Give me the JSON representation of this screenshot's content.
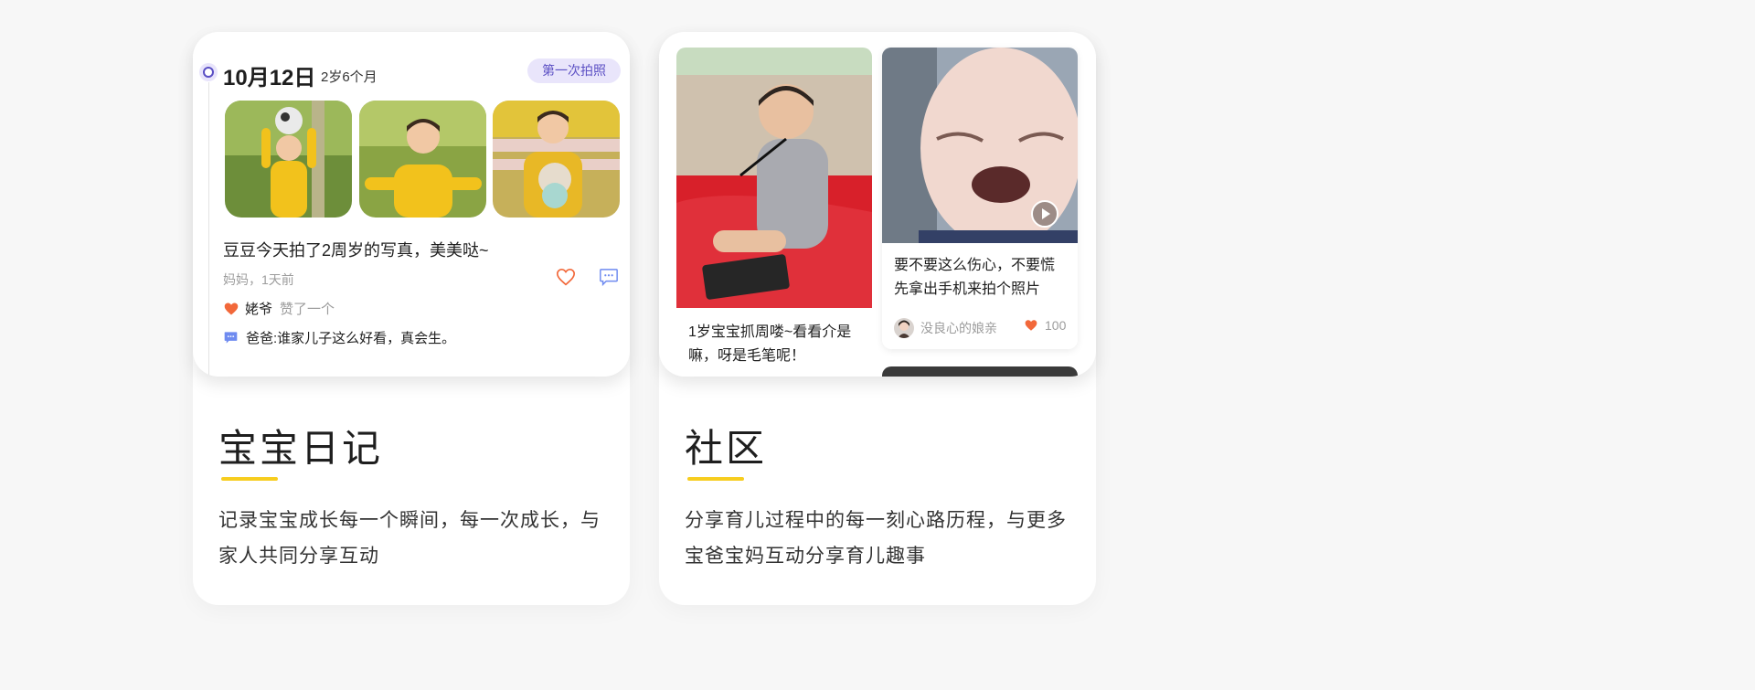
{
  "diary_card": {
    "preview": {
      "date": "10月12日",
      "age": "2岁6个月",
      "badge": "第一次拍照",
      "post_text": "豆豆今天拍了2周岁的写真，美美哒~",
      "meta": "妈妈，1天前",
      "liker": "姥爷",
      "liked_label": "赞了一个",
      "comment": "爸爸:谁家儿子这么好看，真会生。"
    },
    "title": "宝宝日记",
    "description": "记录宝宝成长每一个瞬间，每一次成长，与家人共同分享互动"
  },
  "community_card": {
    "posts": [
      {
        "caption": "1岁宝宝抓周喽~看看介是嘛，呀是毛笔呢！"
      },
      {
        "caption": "要不要这么伤心，不要慌先拿出手机来拍个照片",
        "author": "没良心的娘亲",
        "likes": "100"
      }
    ],
    "title": "社区",
    "description": "分享育儿过程中的每一刻心路历程，与更多宝爸宝妈互动分享育儿趣事"
  },
  "colors": {
    "accent_yellow": "#f7cd1e",
    "heart_orange": "#f2683a",
    "badge_purple": "#5c50c4",
    "comment_blue": "#6f8bf0"
  },
  "icons": [
    "timeline-dot-icon",
    "heart-icon",
    "comment-icon",
    "play-icon"
  ]
}
